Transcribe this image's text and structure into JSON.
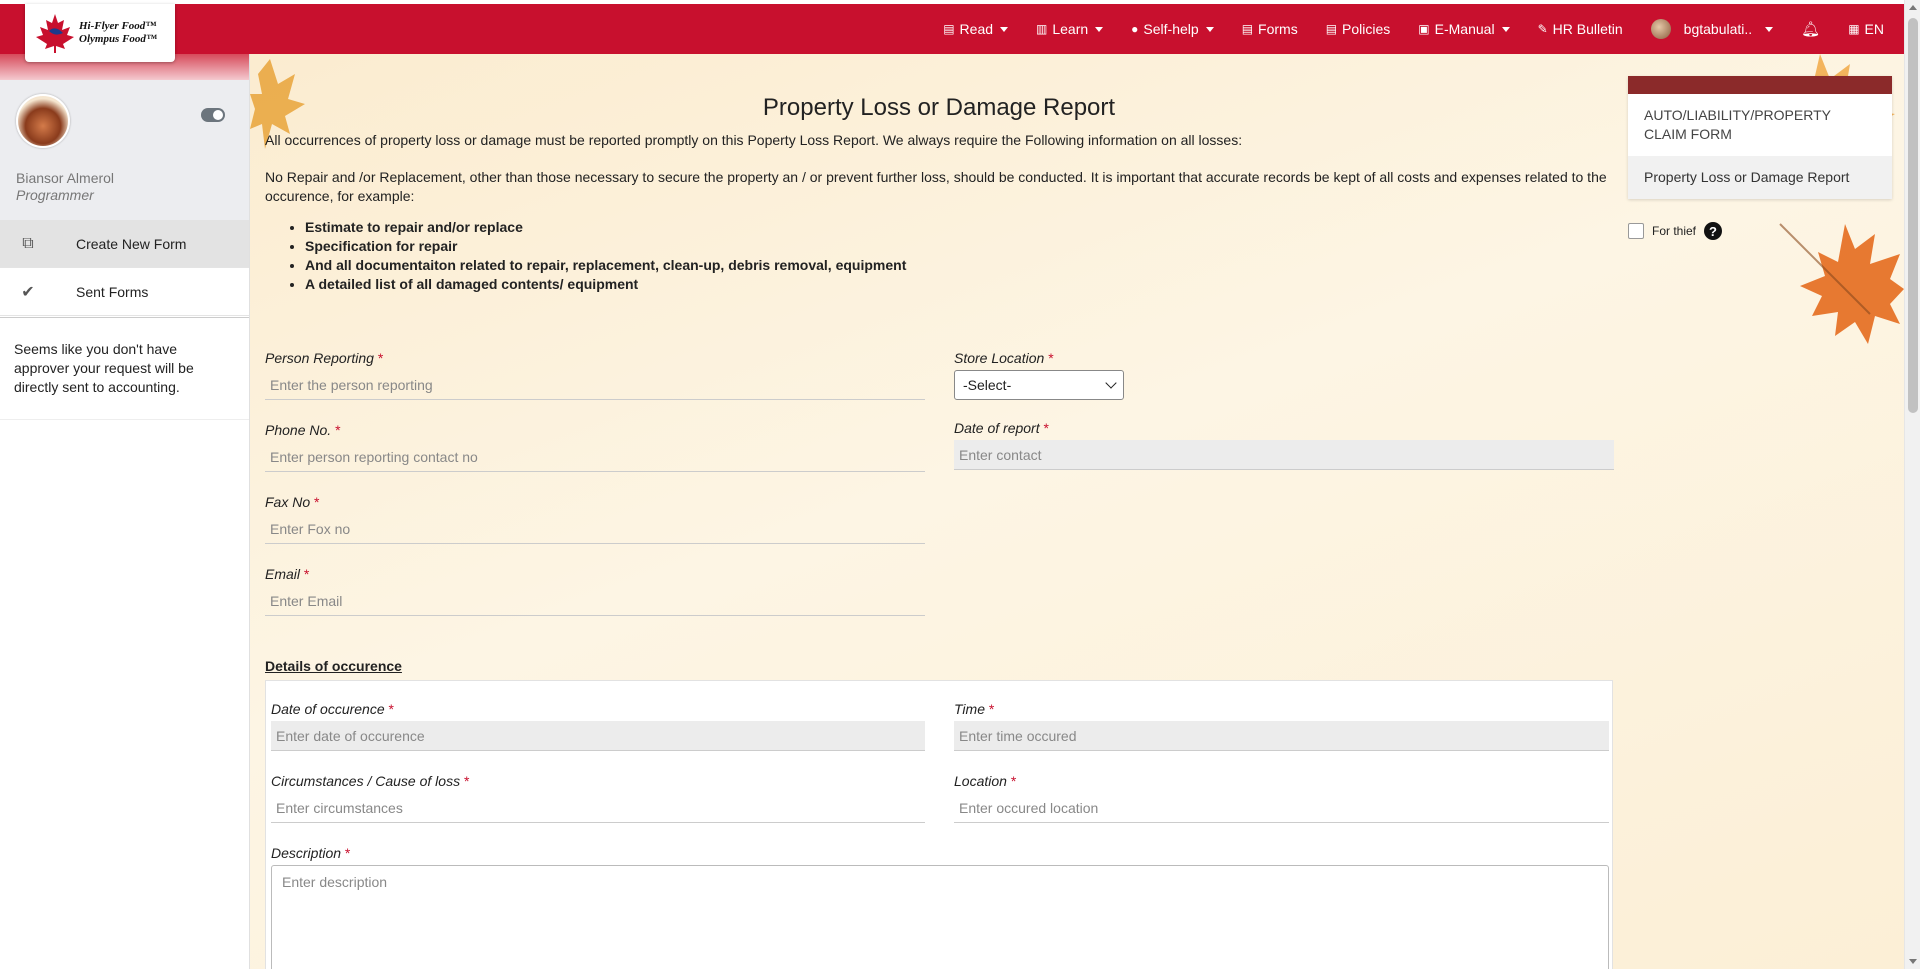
{
  "brand": {
    "line1": "Hi-Flyer Food™",
    "line2": "Olympus Food™"
  },
  "nav": {
    "items": [
      {
        "label": "Read",
        "icon": "newspaper-icon",
        "dropdown": true
      },
      {
        "label": "Learn",
        "icon": "book-icon",
        "dropdown": true
      },
      {
        "label": "Self-help",
        "icon": "self-help-icon",
        "dropdown": true
      },
      {
        "label": "Forms",
        "icon": "forms-icon",
        "dropdown": false
      },
      {
        "label": "Policies",
        "icon": "policies-icon",
        "dropdown": false
      },
      {
        "label": "E-Manual",
        "icon": "manual-icon",
        "dropdown": true
      },
      {
        "label": "HR Bulletin",
        "icon": "pin-icon",
        "dropdown": false
      }
    ],
    "user": "bgtabulati..",
    "lang": "EN"
  },
  "sidebar": {
    "user_name": "Biansor Almerol",
    "user_role": "Programmer",
    "menu": [
      {
        "label": "Create New Form",
        "icon": "copy-icon",
        "active": true
      },
      {
        "label": "Sent Forms",
        "icon": "check-icon",
        "active": false
      }
    ],
    "note": "Seems like you don't have approver your request will be directly sent to accounting."
  },
  "form": {
    "title": "Property Loss or Damage Report",
    "intro": "All occurrences of property loss or damage must be reported promptly on this Poperty Loss Report. We always require the Following information on all losses:",
    "intro2": "No Repair and /or Replacement, other than those necessary to secure the property an / or prevent further loss, should be conducted. It is important that accurate records be kept of all costs and expenses related to the occurence, for example:",
    "bullets": [
      "Estimate to repair and/or replace",
      "Specification for repair",
      "And all documentaiton related to repair, replacement, clean-up, debris removal, equipment",
      "A detailed list of all damaged contents/ equipment"
    ],
    "person_reporting": {
      "label": "Person Reporting",
      "placeholder": "Enter the person reporting"
    },
    "store_location": {
      "label": "Store Location",
      "value": "-Select-"
    },
    "phone": {
      "label": "Phone No.",
      "placeholder": "Enter person reporting contact no"
    },
    "date_report": {
      "label": "Date of report",
      "placeholder": "Enter contact"
    },
    "fax": {
      "label": "Fax No",
      "placeholder": "Enter Fox no"
    },
    "email": {
      "label": "Email",
      "placeholder": "Enter Email"
    },
    "details_title": "Details of occurence",
    "date_occurence": {
      "label": "Date of occurence",
      "placeholder": "Enter date of occurence"
    },
    "time": {
      "label": "Time",
      "placeholder": "Enter time occured"
    },
    "circumstances": {
      "label": "Circumstances / Cause of loss",
      "placeholder": "Enter circumstances"
    },
    "location": {
      "label": "Location",
      "placeholder": "Enter occured location"
    },
    "description": {
      "label": "Description",
      "placeholder": "Enter description"
    },
    "required_mark": "*"
  },
  "right_panel": {
    "items": [
      {
        "label": "AUTO/LIABILITY/PROPERTY CLAIM FORM",
        "selected": false
      },
      {
        "label": "Property Loss or Damage Report",
        "selected": true
      }
    ],
    "for_thief": "For thief"
  },
  "colors": {
    "brand_red": "#c8102e",
    "panel_head": "#8b2a2a",
    "required": "#c8102e"
  }
}
